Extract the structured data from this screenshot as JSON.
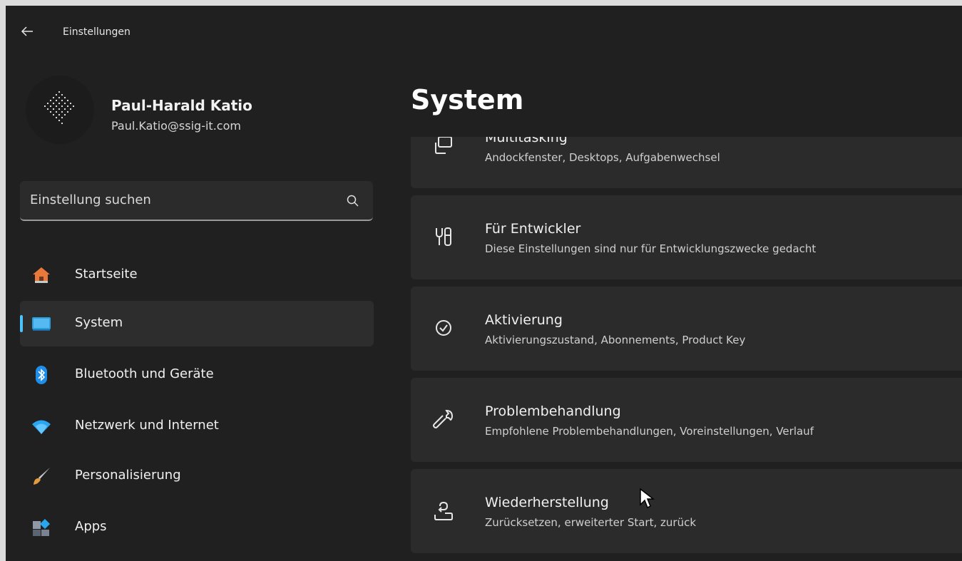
{
  "window": {
    "title": "Einstellungen"
  },
  "user": {
    "name": "Paul-Harald Katio",
    "email": "Paul.Katio@ssig-it.com"
  },
  "search": {
    "placeholder": "Einstellung suchen"
  },
  "nav": [
    {
      "label": "Startseite",
      "icon": "home-icon"
    },
    {
      "label": "System",
      "icon": "system-icon",
      "active": true
    },
    {
      "label": "Bluetooth und Geräte",
      "icon": "bluetooth-icon"
    },
    {
      "label": "Netzwerk und Internet",
      "icon": "wifi-icon"
    },
    {
      "label": "Personalisierung",
      "icon": "brush-icon"
    },
    {
      "label": "Apps",
      "icon": "apps-icon"
    }
  ],
  "page": {
    "title": "System"
  },
  "cards": [
    {
      "title": "Multitasking",
      "subtitle": "Andockfenster, Desktops, Aufgabenwechsel",
      "icon": "multitasking-icon"
    },
    {
      "title": "Für Entwickler",
      "subtitle": "Diese Einstellungen sind nur für Entwicklungszwecke gedacht",
      "icon": "developer-tools-icon"
    },
    {
      "title": "Aktivierung",
      "subtitle": "Aktivierungszustand, Abonnements, Product Key",
      "icon": "check-circle-icon"
    },
    {
      "title": "Problembehandlung",
      "subtitle": "Empfohlene Problembehandlungen, Voreinstellungen, Verlauf",
      "icon": "wrench-icon"
    },
    {
      "title": "Wiederherstellung",
      "subtitle": "Zurücksetzen, erweiterter Start, zurück",
      "icon": "recovery-icon"
    }
  ]
}
